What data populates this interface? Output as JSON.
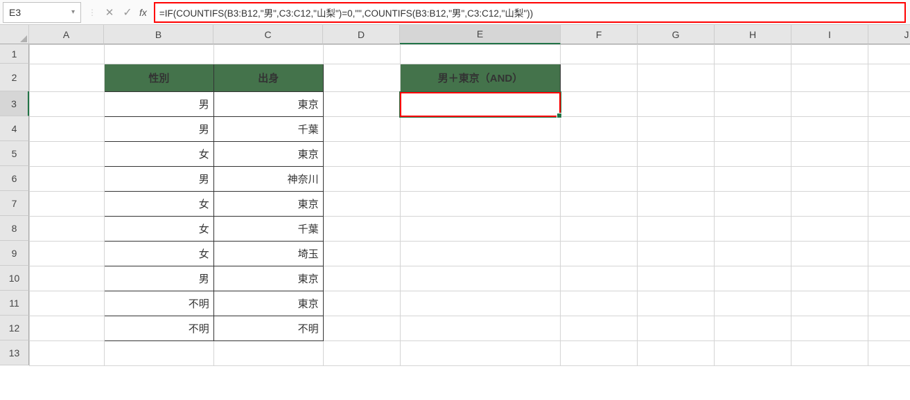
{
  "nameBox": "E3",
  "formula": "=IF(COUNTIFS(B3:B12,\"男\",C3:C12,\"山梨\")=0,\"\",COUNTIFS(B3:B12,\"男\",C3:C12,\"山梨\"))",
  "fxLabel": "fx",
  "columns": [
    "A",
    "B",
    "C",
    "D",
    "E",
    "F",
    "G",
    "H",
    "I",
    "J"
  ],
  "rows": [
    "1",
    "2",
    "3",
    "4",
    "5",
    "6",
    "7",
    "8",
    "9",
    "10",
    "11",
    "12",
    "13"
  ],
  "activeCol": "E",
  "activeRow": "3",
  "headers": {
    "B2": "性別",
    "C2": "出身",
    "E2": "男＋東京（AND）"
  },
  "table": [
    {
      "sex": "男",
      "origin": "東京"
    },
    {
      "sex": "男",
      "origin": "千葉"
    },
    {
      "sex": "女",
      "origin": "東京"
    },
    {
      "sex": "男",
      "origin": "神奈川"
    },
    {
      "sex": "女",
      "origin": "東京"
    },
    {
      "sex": "女",
      "origin": "千葉"
    },
    {
      "sex": "女",
      "origin": "埼玉"
    },
    {
      "sex": "男",
      "origin": "東京"
    },
    {
      "sex": "不明",
      "origin": "東京"
    },
    {
      "sex": "不明",
      "origin": "不明"
    }
  ],
  "E3": ""
}
